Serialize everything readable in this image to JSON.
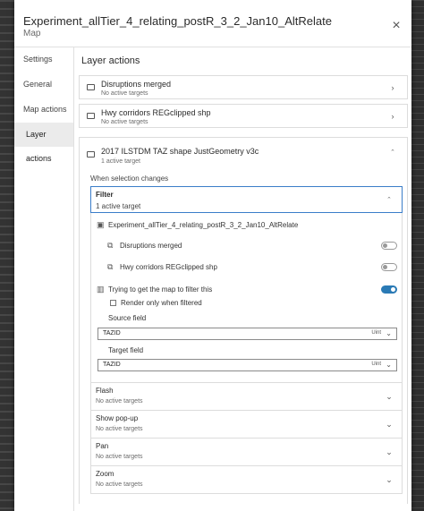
{
  "dialog": {
    "title": "Experiment_allTier_4_relating_postR_3_2_Jan10_AltRelate",
    "subtitle": "Map"
  },
  "sidebar": {
    "items": [
      {
        "label": "Settings"
      },
      {
        "label": "General"
      },
      {
        "label": "Map actions"
      },
      {
        "label": "Layer actions"
      }
    ]
  },
  "main": {
    "section_title": "Layer actions",
    "layers": [
      {
        "name": "Disruptions merged",
        "status": "No active targets"
      },
      {
        "name": "Hwy corridors REGclipped shp",
        "status": "No active targets"
      },
      {
        "name": "2017 ILSTDM TAZ shape JustGeometry v3c",
        "status": "1 active target"
      }
    ],
    "when_label": "When selection changes",
    "filter": {
      "title": "Filter",
      "status": "1 active target",
      "map_name": "Experiment_allTier_4_relating_postR_3_2_Jan10_AltRelate",
      "targets": [
        {
          "name": "Disruptions merged",
          "enabled": false
        },
        {
          "name": "Hwy corridors REGclipped shp",
          "enabled": false
        },
        {
          "name": "Trying to get the map to filter this",
          "enabled": true
        }
      ],
      "render_only_label": "Render only when filtered",
      "source_field_label": "Source field",
      "source_field_value": "TAZID",
      "source_field_type": "Uint",
      "target_field_label": "Target field",
      "target_field_value": "TAZID",
      "target_field_type": "Uint"
    },
    "actions": [
      {
        "title": "Flash",
        "status": "No active targets"
      },
      {
        "title": "Show pop-up",
        "status": "No active targets"
      },
      {
        "title": "Pan",
        "status": "No active targets"
      },
      {
        "title": "Zoom",
        "status": "No active targets"
      }
    ]
  },
  "colors": {
    "accent": "#2a7ab5",
    "focus": "#3a7dc9"
  }
}
